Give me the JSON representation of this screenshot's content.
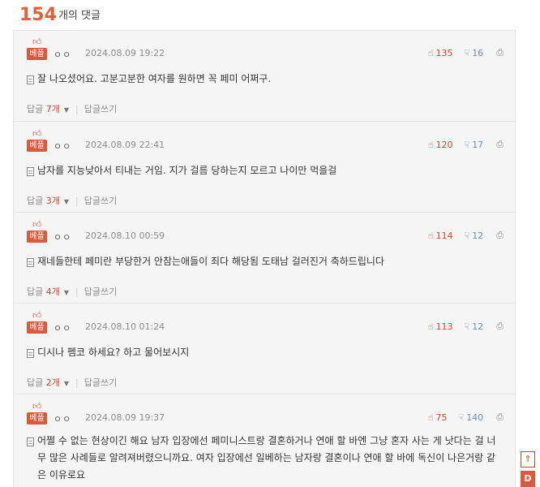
{
  "header": {
    "count": "154",
    "text": "개의 댓글"
  },
  "comments": [
    {
      "badge": "베플",
      "author": "ㅇㅇ",
      "date": "2024.08.09 19:22",
      "up": "135",
      "down": "16",
      "text": "잘 나오셨어요. 고분고분한 여자를 원하면 꼭 페미 어쩌구.",
      "reply_label": "답글",
      "reply_count": "7개",
      "write_label": "답글쓰기"
    },
    {
      "badge": "베플",
      "author": "ㅇㅇ",
      "date": "2024.08.09 22:41",
      "up": "120",
      "down": "17",
      "text": "남자를 지능낮아서 티내는 거임. 지가 걸름 당하는지 모르고 나이만 먹을걸",
      "reply_label": "답글",
      "reply_count": "3개",
      "write_label": "답글쓰기"
    },
    {
      "badge": "베플",
      "author": "ㅇㅇ",
      "date": "2024.08.10 00:59",
      "up": "114",
      "down": "12",
      "text": "재네들한테 페미란 부당한거 안참는애들이 죄다 해당됨 도태남 걸러진거 축하드립니다",
      "reply_label": "답글",
      "reply_count": "4개",
      "write_label": "답글쓰기"
    },
    {
      "badge": "베플",
      "author": "ㅇㅇ",
      "date": "2024.08.10 01:24",
      "up": "113",
      "down": "12",
      "text": "디시나 펨코 하세요? 하고 물어보시지",
      "reply_label": "답글",
      "reply_count": "2개",
      "write_label": "답글쓰기"
    },
    {
      "badge": "베플",
      "author": "ㅇㅇ",
      "date": "2024.08.09 19:37",
      "up": "75",
      "down": "140",
      "text": "어쩔 수 없는 현상이긴 해요 남자 입장에선 페미니스트랑 결혼하거나 연애 할 바엔 그냥 혼자 사는 게 낫다는 걸 너무 많은 사례들로 알려져버렸으니까요. 여자 입장에선 일베하는 남자랑 결혼이나 연애 할 바에 독신이 나은거랑 같은 이유로요",
      "reply_label": "",
      "reply_count": "",
      "write_label": ""
    }
  ],
  "side_buttons": {
    "top_label": "맨위",
    "next_label": "D"
  },
  "icons": {
    "thumb_up": "thumb-up-icon",
    "thumb_down": "thumb-down-icon",
    "report": "report-icon",
    "document": "document-icon",
    "best": "best-badge-icon"
  },
  "colors": {
    "accent": "#e0603d",
    "up": "#d0492c",
    "down": "#6b8bb0"
  }
}
